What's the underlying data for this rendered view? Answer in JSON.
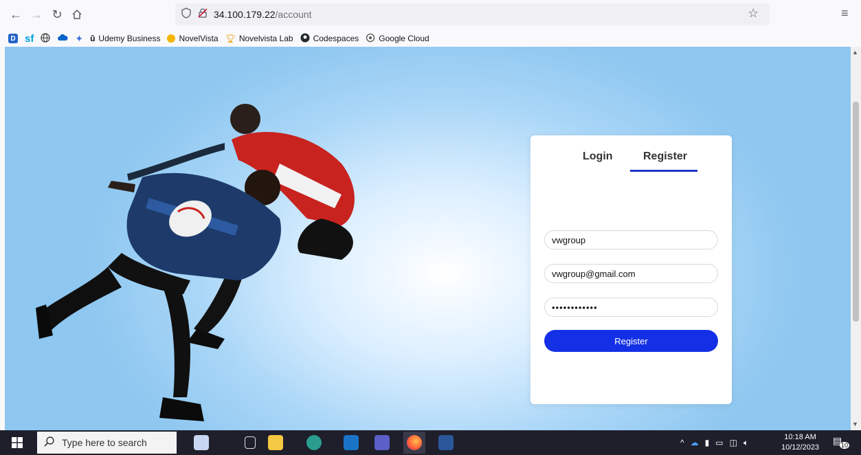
{
  "browser": {
    "url_host": "34.100.179.22",
    "url_path": "/account",
    "bookmarks": [
      "sf",
      "Udemy Business",
      "NovelVista",
      "Novelvista Lab",
      "Codespaces",
      "Google Cloud"
    ]
  },
  "auth_card": {
    "tab_login": "Login",
    "tab_register": "Register",
    "active_tab": "Register",
    "username_value": "vwgroup",
    "email_value": "vwgroup@gmail.com",
    "password_value": "••••••••••••",
    "submit_label": "Register"
  },
  "taskbar": {
    "search_placeholder": "Type here to search",
    "time": "10:18 AM",
    "date": "10/12/2023",
    "notification_count": "10"
  },
  "colors": {
    "accent": "#1430e6",
    "tab_underline": "#1f36c7",
    "bg_blue": "#8ec7f0"
  }
}
